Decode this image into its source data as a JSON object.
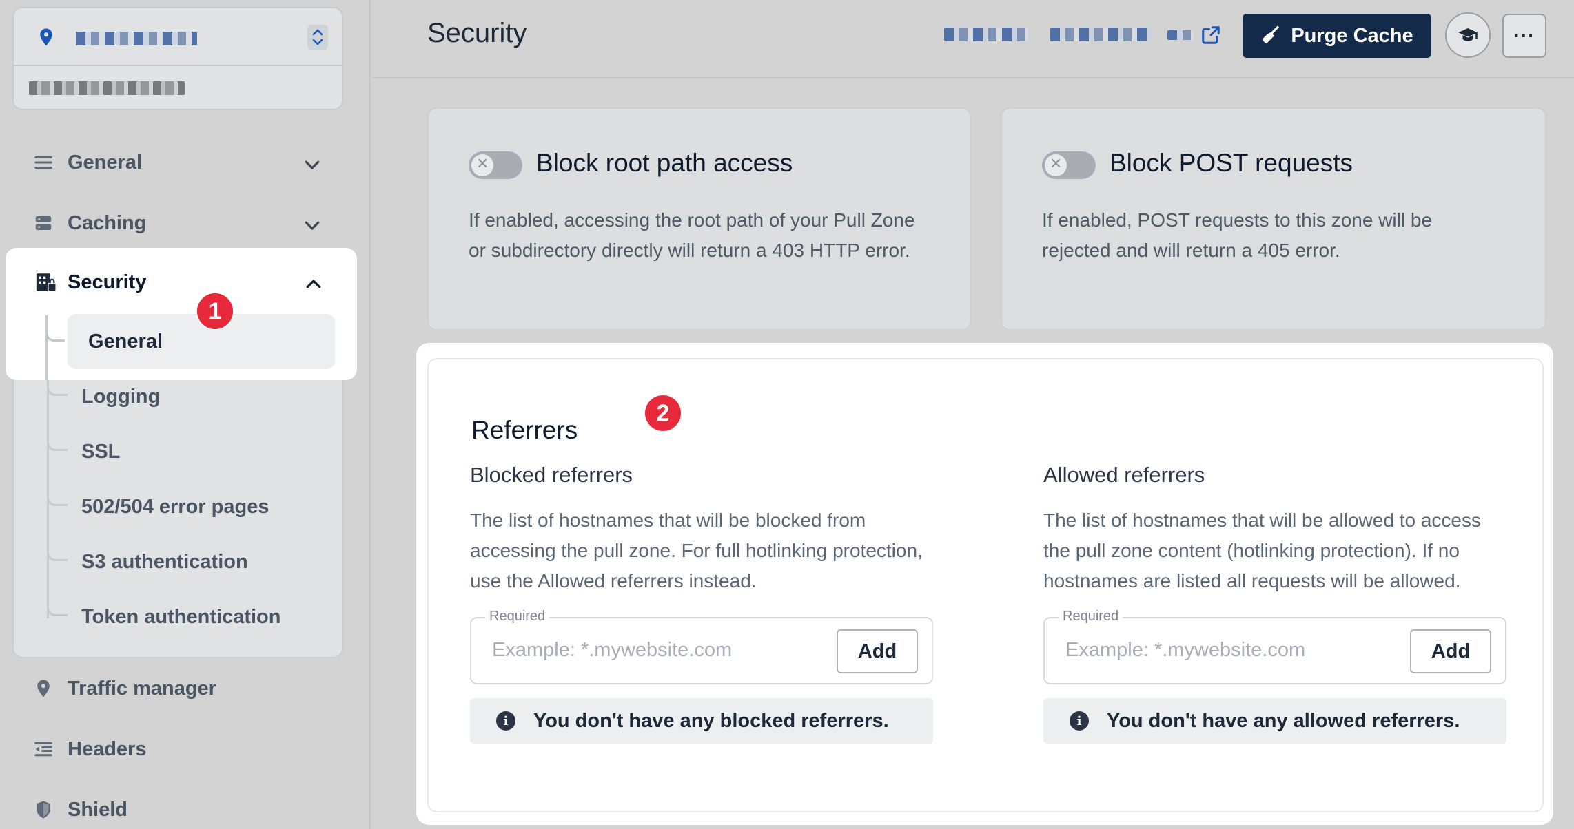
{
  "sidebar": {
    "nav": [
      {
        "label": "General",
        "icon": "list-icon"
      },
      {
        "label": "Caching",
        "icon": "server-icon"
      },
      {
        "label": "Security",
        "icon": "building-lock-icon"
      },
      {
        "label": "Traffic manager",
        "icon": "map-pin-icon"
      },
      {
        "label": "Headers",
        "icon": "indent-icon"
      },
      {
        "label": "Shield",
        "icon": "shield-icon"
      }
    ],
    "security_sub": [
      "General",
      "Logging",
      "SSL",
      "502/504 error pages",
      "S3 authentication",
      "Token authentication"
    ]
  },
  "header": {
    "title": "Security",
    "purge_label": "Purge Cache",
    "more_label": "···"
  },
  "cards": [
    {
      "title": "Block root path access",
      "desc": "If enabled, accessing the root path of your Pull Zone or subdirectory directly will return a 403 HTTP error."
    },
    {
      "title": "Block POST requests",
      "desc": "If enabled, POST requests to this zone will be rejected and will return a 405 error."
    }
  ],
  "referrers": {
    "title": "Referrers",
    "blocked": {
      "heading": "Blocked referrers",
      "desc": "The list of hostnames that will be blocked from accessing the pull zone. For full hotlinking protection, use the Allowed referrers instead.",
      "field_label": "Required",
      "placeholder": "Example: *.mywebsite.com",
      "add_label": "Add",
      "empty": "You don't have any blocked referrers."
    },
    "allowed": {
      "heading": "Allowed referrers",
      "desc": "The list of hostnames that will be allowed to access the pull zone content (hotlinking protection). If no hostnames are listed all requests will be allowed.",
      "field_label": "Required",
      "placeholder": "Example: *.mywebsite.com",
      "add_label": "Add",
      "empty": "You don't have any allowed referrers."
    }
  },
  "badges": [
    "1",
    "2"
  ],
  "colors": {
    "accent": "#132a4a",
    "badge": "#e8283b"
  }
}
